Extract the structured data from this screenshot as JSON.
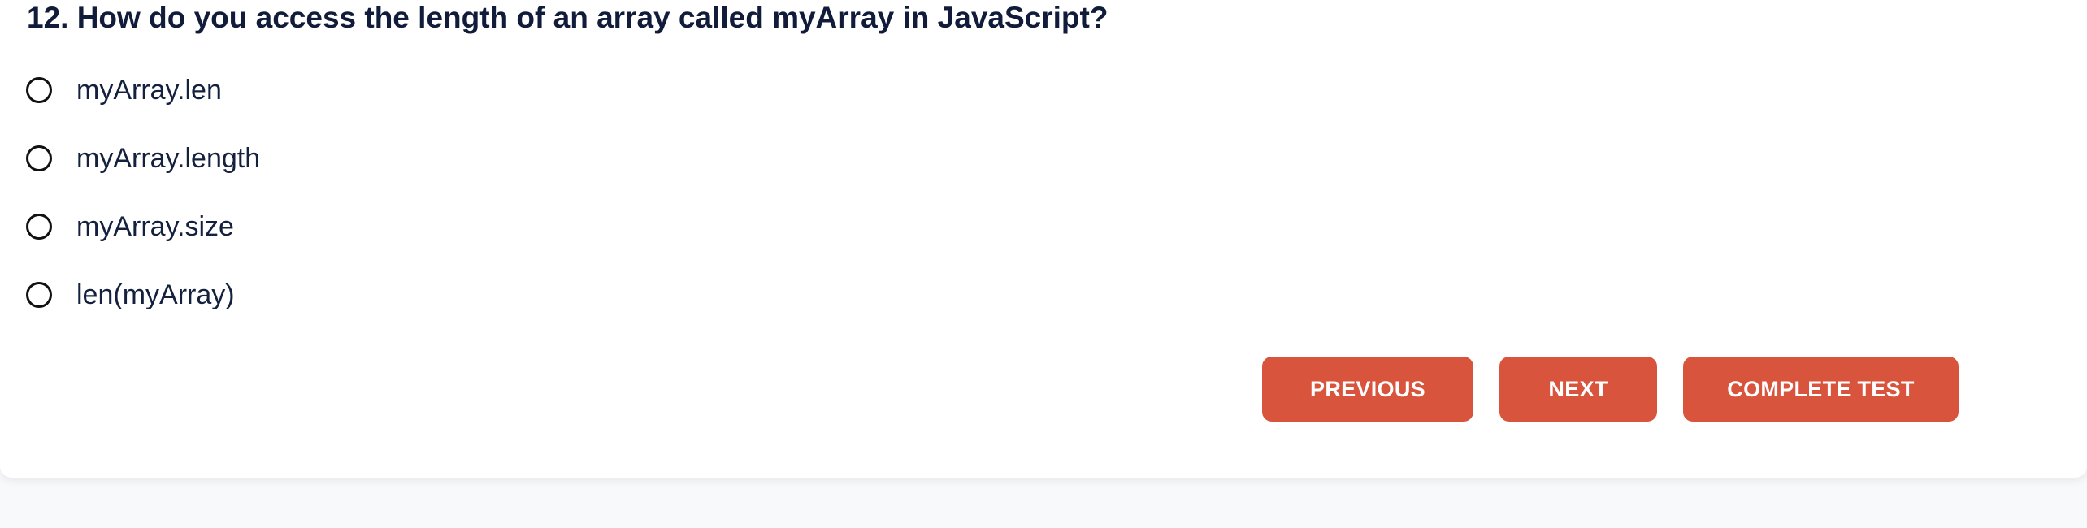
{
  "question": {
    "text": "12. How do you access the length of an array called myArray in JavaScript?"
  },
  "options": [
    {
      "label": "myArray.len"
    },
    {
      "label": "myArray.length"
    },
    {
      "label": "myArray.size"
    },
    {
      "label": "len(myArray)"
    }
  ],
  "buttons": {
    "previous": "PREVIOUS",
    "next": "NEXT",
    "complete": "COMPLETE TEST"
  },
  "colors": {
    "accent": "#d9543d",
    "text": "#101c3a",
    "background": "#f8f9fb"
  }
}
